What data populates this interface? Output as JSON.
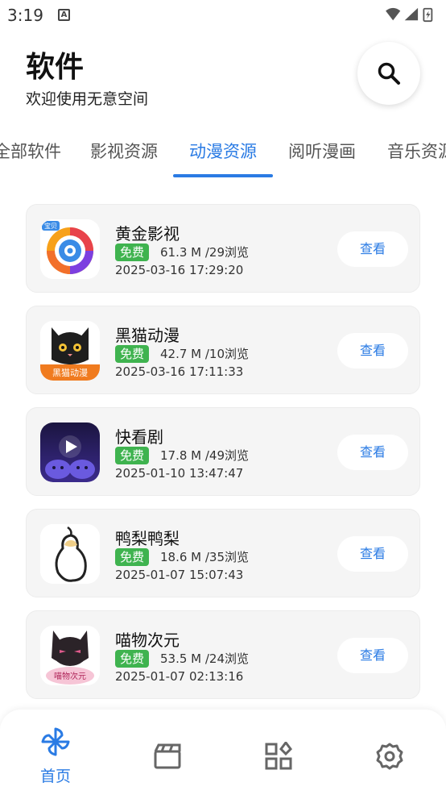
{
  "status_bar": {
    "time": "3:19",
    "notif_glyph": "A"
  },
  "header": {
    "title": "软件",
    "subtitle": "欢迎使用无意空间"
  },
  "tabs": [
    {
      "label": "全部软件"
    },
    {
      "label": "影视资源"
    },
    {
      "label": "动漫资源"
    },
    {
      "label": "阅听漫画"
    },
    {
      "label": "音乐资源"
    }
  ],
  "active_tab": "动漫资源",
  "apps": [
    {
      "name": "黄金影视",
      "badge": "免费",
      "stats": "61.3 M /29浏览",
      "date": "2025-03-16 17:29:20",
      "action": "查看"
    },
    {
      "name": "黑猫动漫",
      "badge": "免费",
      "stats": "42.7 M /10浏览",
      "date": "2025-03-16 17:11:33",
      "action": "查看"
    },
    {
      "name": "快看剧",
      "badge": "免费",
      "stats": "17.8 M /49浏览",
      "date": "2025-01-10 13:47:47",
      "action": "查看"
    },
    {
      "name": "鸭梨鸭梨",
      "badge": "免费",
      "stats": "18.6 M /35浏览",
      "date": "2025-01-07 15:07:43",
      "action": "查看"
    },
    {
      "name": "喵物次元",
      "badge": "免费",
      "stats": "53.5 M /24浏览",
      "date": "2025-01-07 02:13:16",
      "action": "查看"
    }
  ],
  "icon_texts": {
    "huangjin": "宝贝",
    "heimao": "黑猫动漫",
    "miaowu": "喵物次元"
  },
  "bottom_nav": {
    "home_label": "首页"
  },
  "colors": {
    "accent": "#2a7be4",
    "badge": "#3fb34f"
  }
}
